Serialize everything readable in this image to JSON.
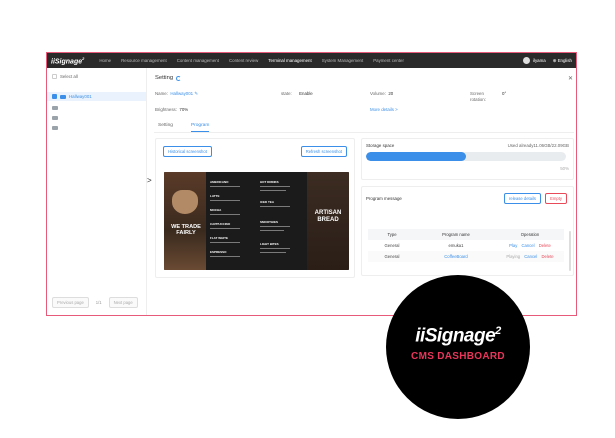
{
  "app": {
    "logo_text": "iiSignage",
    "logo_sup": "2",
    "nav": [
      "Home",
      "Resource management",
      "Content management",
      "Content review",
      "Terminal management",
      "System Management",
      "Payment center"
    ],
    "active_nav": "Terminal management",
    "user": "ilyama",
    "language": "English"
  },
  "sidebar": {
    "select_all": "Select all",
    "devices": [
      {
        "label": "Hallway001",
        "selected": true
      },
      {
        "label": ""
      },
      {
        "label": ""
      },
      {
        "label": ""
      }
    ],
    "pager": {
      "prev": "Previous page",
      "page": "1/1",
      "next": "Next page"
    }
  },
  "setting": {
    "title": "Setting",
    "name_label": "Name:",
    "name_value": "Hallway001",
    "state_label": "state:",
    "state_value": "Enable",
    "volume_label": "Volume:",
    "volume_value": "20",
    "rotation_label": "Screen rotation:",
    "rotation_value": "0°",
    "brightness_label": "Brightness:",
    "brightness_value": "70%",
    "more_details": "More details >"
  },
  "tabs": [
    "Setting",
    "Program"
  ],
  "active_tab": "Program",
  "screenshot": {
    "historical": "Historical screenshot",
    "refresh": "Refresh screenshot",
    "menu_texts": {
      "left": "WE TRADE FAIRLY",
      "right": "ARTISAN BREAD",
      "col1": [
        "AMERICANO",
        "LATTE",
        "MOCHA",
        "CAPPUCCINO",
        "FLAT WHITE",
        "ESPRESSO"
      ],
      "col2": [
        "HOT DRINKS",
        "ICED TEA",
        "SMOOTHIES",
        "LIGHT BITES"
      ]
    }
  },
  "storage": {
    "label": "Storage space",
    "used_text": "Used already11.06GB/22.09GB",
    "percent_text": "50%",
    "fraction": 0.5
  },
  "program": {
    "label": "Program message",
    "release_details": "release details",
    "empty": "Empty",
    "columns": [
      "Type",
      "Program name",
      "Operation"
    ],
    "rows": [
      {
        "type": "General",
        "name": "emuka1",
        "ops": [
          "Play",
          "Cancel",
          "Delete"
        ]
      },
      {
        "type": "General",
        "name": "CoffeeBoard",
        "ops": [
          "Playing",
          "Cancel",
          "Delete"
        ]
      }
    ]
  },
  "badge": {
    "logo": "iiSignage",
    "sup": "2",
    "subtitle": "CMS DASHBOARD"
  }
}
